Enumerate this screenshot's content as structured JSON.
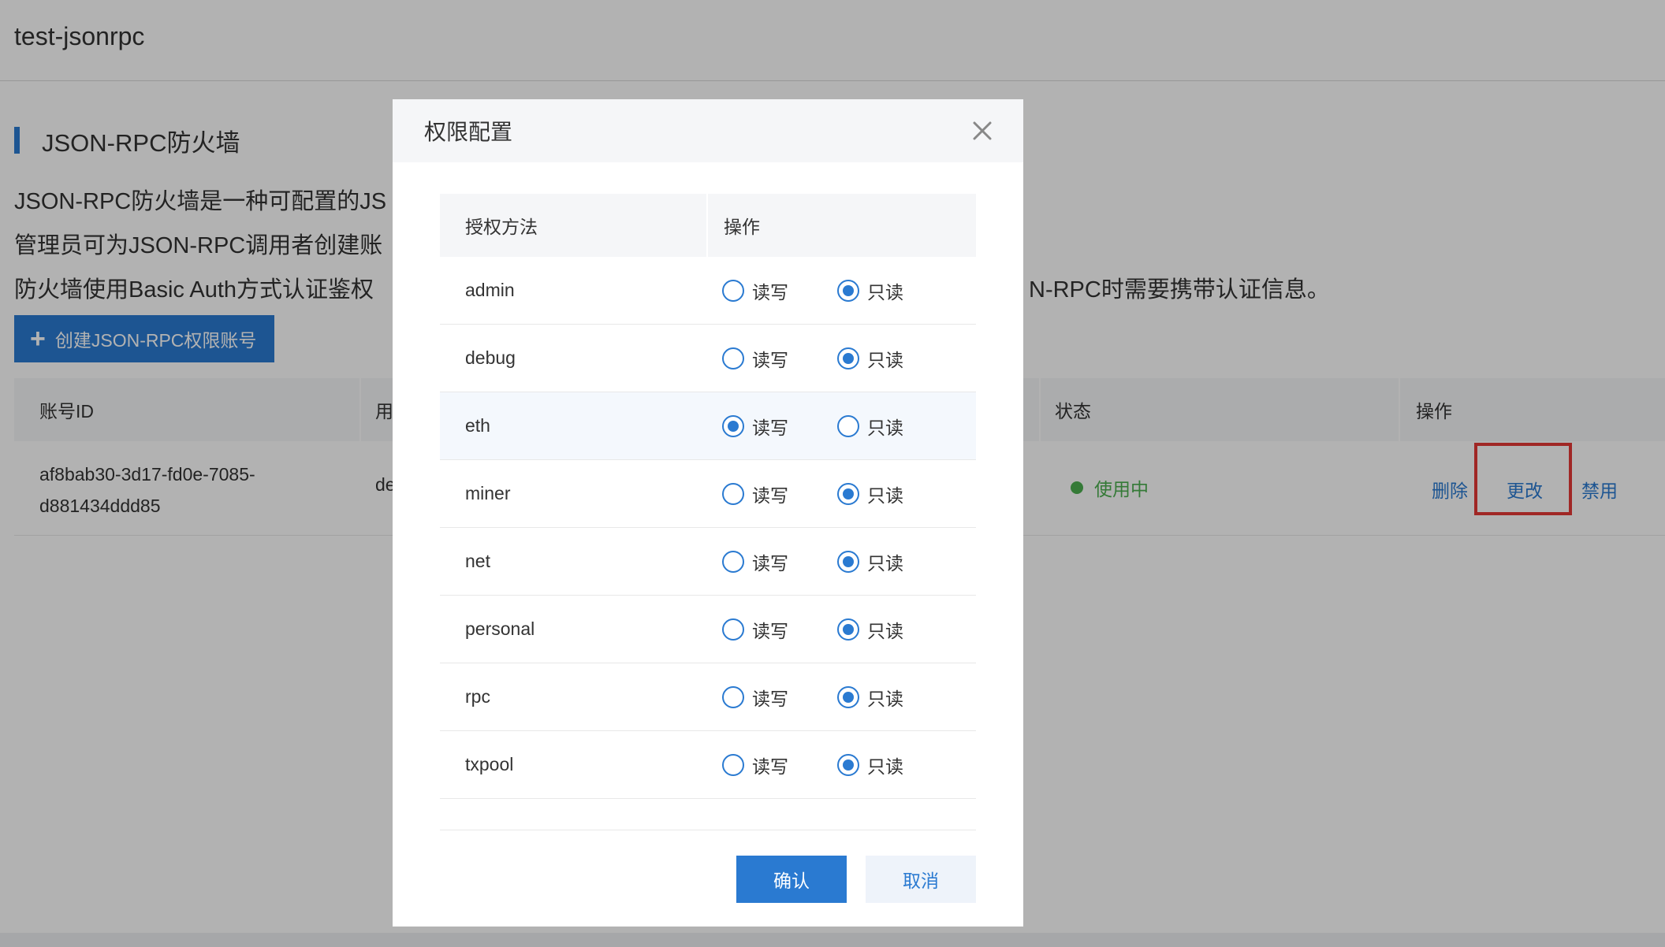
{
  "page": {
    "title": "test-jsonrpc",
    "section_title": "JSON-RPC防火墙",
    "description_lines": [
      "JSON-RPC防火墙是一种可配置的JS",
      "管理员可为JSON-RPC调用者创建账",
      "防火墙使用Basic Auth方式认证鉴权"
    ],
    "description_line3_tail": "N-RPC时需要携带认证信息。",
    "create_button": "创建JSON-RPC权限账号"
  },
  "accounts_table": {
    "headers": [
      "账号ID",
      "用",
      "状态",
      "操作"
    ],
    "rows": [
      {
        "id_line1": "af8bab30-3d17-fd0e-7085-",
        "id_line2": "d881434ddd85",
        "user": "de",
        "status": "使用中",
        "actions": [
          "删除",
          "更改",
          "禁用"
        ]
      }
    ]
  },
  "modal": {
    "title": "权限配置",
    "headers": [
      "授权方法",
      "操作"
    ],
    "option_labels": {
      "read_write": "读写",
      "read_only": "只读"
    },
    "rows": [
      {
        "method": "admin",
        "selected": "read_only"
      },
      {
        "method": "debug",
        "selected": "read_only"
      },
      {
        "method": "eth",
        "selected": "read_write"
      },
      {
        "method": "miner",
        "selected": "read_only"
      },
      {
        "method": "net",
        "selected": "read_only"
      },
      {
        "method": "personal",
        "selected": "read_only"
      },
      {
        "method": "rpc",
        "selected": "read_only"
      },
      {
        "method": "txpool",
        "selected": "read_only"
      }
    ],
    "confirm": "确认",
    "cancel": "取消"
  },
  "colors": {
    "accent": "#2a7ad1",
    "status_active": "#4caf50",
    "highlight_box": "#e53935"
  }
}
